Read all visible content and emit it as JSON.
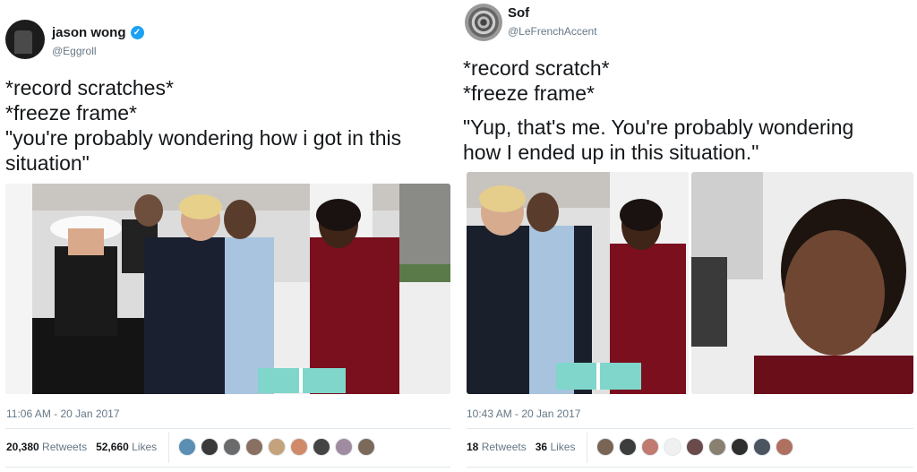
{
  "tweets": [
    {
      "author": {
        "name": "jason wong",
        "handle": "@Eggroll",
        "verified": true
      },
      "lines": [
        "*record scratches*",
        "*freeze frame*",
        "\"you're probably wondering how i got in this",
        "situation\""
      ],
      "timestamp": "11:06 AM - 20 Jan 2017",
      "retweets": {
        "count": "20,380",
        "label": "Retweets"
      },
      "likes": {
        "count": "52,660",
        "label": "Likes"
      },
      "liker_colors": [
        "#5a8fb3",
        "#3a3a3a",
        "#6b6b6b",
        "#8a7060",
        "#c4a27c",
        "#d08a6a",
        "#444444",
        "#a08ca0",
        "#7b6a5a"
      ]
    },
    {
      "author": {
        "name": "Sof",
        "handle": "@LeFrenchAccent",
        "verified": false
      },
      "lines": [
        "*record scratch*",
        "*freeze frame*",
        "",
        "\"Yup, that's me. You're probably wondering",
        "how I ended up in this situation.\""
      ],
      "timestamp": "10:43 AM - 20 Jan 2017",
      "retweets": {
        "count": "18",
        "label": "Retweets"
      },
      "likes": {
        "count": "36",
        "label": "Likes"
      },
      "liker_colors": [
        "#7a6555",
        "#3d3d3d",
        "#c07a70",
        "#f0f0f0",
        "#6a4a4a",
        "#8a8070",
        "#2f2f2f",
        "#4a5560",
        "#b07060"
      ]
    }
  ]
}
